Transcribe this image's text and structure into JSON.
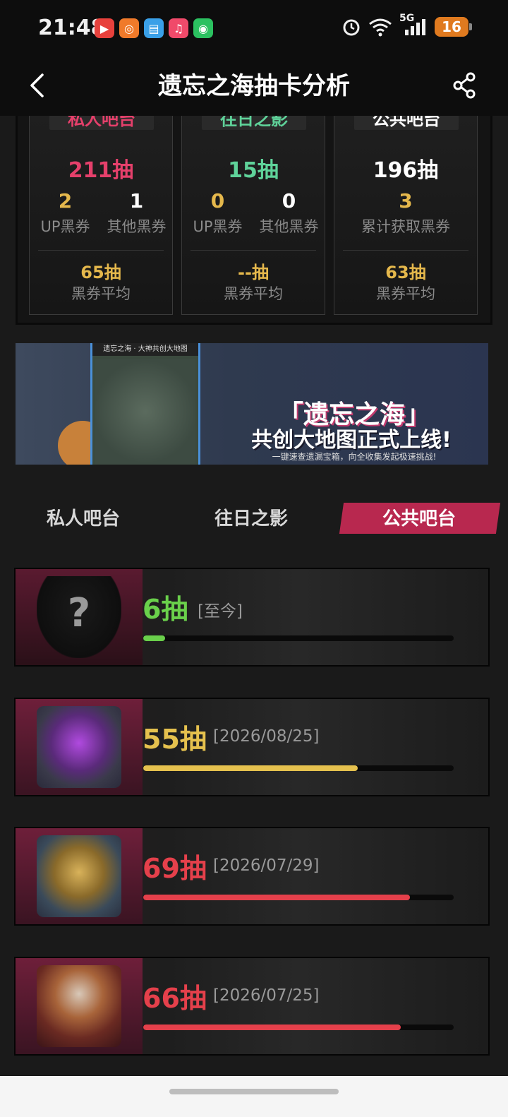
{
  "status_bar": {
    "time": "21:48",
    "network": "5G",
    "battery": "16"
  },
  "nav": {
    "title": "遗忘之海抽卡分析"
  },
  "stats": [
    {
      "name": "私人吧台",
      "name_color": "#e5406b",
      "total": "211抽",
      "total_color": "#e5406b",
      "counts": [
        {
          "value": "2",
          "label": "UP黑券",
          "color": "#e5b84c"
        },
        {
          "value": "1",
          "label": "其他黑券",
          "color": "#ffffff"
        }
      ],
      "avg": "65抽",
      "avg_label": "黑券平均"
    },
    {
      "name": "往日之影",
      "name_color": "#5fd39a",
      "total": "15抽",
      "total_color": "#5fd39a",
      "counts": [
        {
          "value": "0",
          "label": "UP黑券",
          "color": "#e5b84c"
        },
        {
          "value": "0",
          "label": "其他黑券",
          "color": "#ffffff"
        }
      ],
      "avg": "--抽",
      "avg_label": "黑券平均"
    },
    {
      "name": "公共吧台",
      "name_color": "#ffffff",
      "total": "196抽",
      "total_color": "#ffffff",
      "counts": [
        {
          "value": "3",
          "label": "累计获取黑券",
          "color": "#e5b84c"
        }
      ],
      "avg": "63抽",
      "avg_label": "黑券平均"
    }
  ],
  "banner": {
    "phone_title": "遗忘之海 · 大神共创大地图",
    "title_line1": "「遗忘之海」",
    "title_line2": "共创大地图正式上线!",
    "subtitle": "一键速查遗漏宝箱，向全收集发起极速挑战!"
  },
  "tabs": [
    {
      "label": "私人吧台",
      "active": false
    },
    {
      "label": "往日之影",
      "active": false
    },
    {
      "label": "公共吧台",
      "active": true
    }
  ],
  "pulls": [
    {
      "count": "6抽",
      "date": "[至今]",
      "color": "#6ad04b",
      "progress": 0.07,
      "portrait": "unknown-character"
    },
    {
      "count": "55抽",
      "date": "[2026/08/25]",
      "color": "#e5c14e",
      "progress": 0.69,
      "portrait": "purple-card-character"
    },
    {
      "count": "69抽",
      "date": "[2026/07/29]",
      "color": "#e5404b",
      "progress": 0.86,
      "portrait": "gold-frame-character"
    },
    {
      "count": "66抽",
      "date": "[2026/07/25]",
      "color": "#e5404b",
      "progress": 0.83,
      "portrait": "armored-character"
    }
  ]
}
